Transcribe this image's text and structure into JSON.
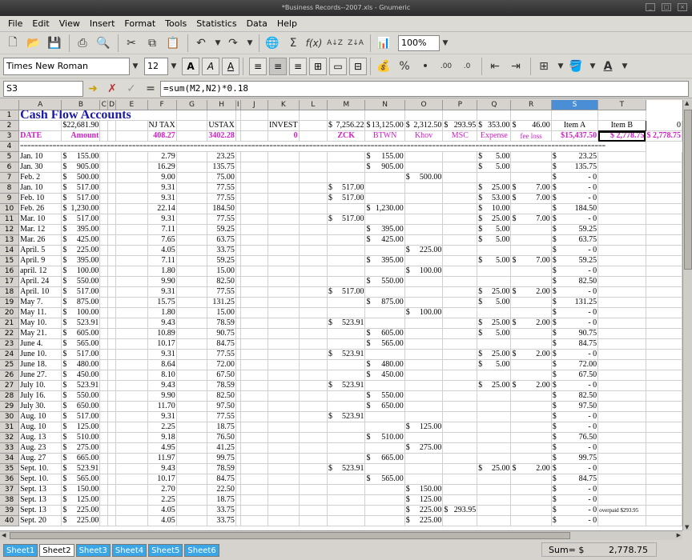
{
  "window": {
    "title": "*Business Records--2007.xls - Gnumeric"
  },
  "menu": [
    "File",
    "Edit",
    "View",
    "Insert",
    "Format",
    "Tools",
    "Statistics",
    "Data",
    "Help"
  ],
  "toolbar": {
    "zoom": "100%"
  },
  "format": {
    "font": "Times New Roman",
    "size": "12"
  },
  "formula_bar": {
    "cell_ref": "S3",
    "formula": "=sum(M2,N2)*0.18"
  },
  "columns": [
    "A",
    "B",
    "C",
    "D",
    "E",
    "F",
    "G",
    "H",
    "I",
    "J",
    "K",
    "L",
    "M",
    "N",
    "O",
    "P",
    "Q",
    "R",
    "S",
    "T"
  ],
  "visible_columns": [
    "A",
    "B",
    "C",
    "D",
    "E",
    "F",
    "G",
    "H",
    "I",
    "J",
    "K",
    "L",
    "M",
    "N",
    "O",
    "P",
    "Q",
    "R",
    "S",
    "T"
  ],
  "row1": {
    "title": "Cash Flow Accounts"
  },
  "row2": {
    "b_cur": "$",
    "b": "22,681.90",
    "e": "NJ TAX",
    "g": "USTAX",
    "j": "INVEST",
    "l_cur": "$",
    "l": "7,256.22",
    "m_cur": "$",
    "m": "13,125.00",
    "n_cur": "$",
    "n": "2,312.50",
    "o_cur": "$",
    "o": "293.95",
    "p_cur": "$",
    "p": "353.00",
    "q_cur": "$",
    "q": "46.00",
    "r": "Item A",
    "s": "Item B",
    "t": "0"
  },
  "row3": {
    "a": "DATE",
    "b": "Amount",
    "e": "408.27",
    "g": "3402.28",
    "j": "0",
    "l": "ZCK",
    "m": "BTWN",
    "n": "Khov",
    "o": "MSC",
    "p": "Expense",
    "q": "fee loss",
    "r": "$15,437.50",
    "s": "$ 2,778.75",
    "t": "$ 2,778.75"
  },
  "row4": {
    "separator": "=================================================================================================================================================================="
  },
  "rows": [
    {
      "n": 5,
      "a": "Jan. 10",
      "b": "155.00",
      "e": "2.79",
      "g": "23.25",
      "l": "",
      "m": "155.00",
      "n2": "",
      "o": "",
      "p": "5.00",
      "q": "",
      "r": "23.25",
      "s": ""
    },
    {
      "n": 6,
      "a": "Jan. 30",
      "b": "905.00",
      "e": "16.29",
      "g": "135.75",
      "l": "",
      "m": "905.00",
      "n2": "",
      "o": "",
      "p": "5.00",
      "q": "",
      "r": "135.75",
      "s": ""
    },
    {
      "n": 7,
      "a": "Feb. 2",
      "b": "500.00",
      "e": "9.00",
      "g": "75.00",
      "l": "",
      "m": "",
      "n2": "500.00",
      "o": "",
      "p": "",
      "q": "",
      "r": "- 0",
      "s": ""
    },
    {
      "n": 8,
      "a": "Jan. 10",
      "b": "517.00",
      "e": "9.31",
      "g": "77.55",
      "l": "517.00",
      "m": "",
      "n2": "",
      "o": "",
      "p": "25.00",
      "q": "7.00",
      "r": "- 0",
      "s": ""
    },
    {
      "n": 9,
      "a": "Feb. 10",
      "b": "517.00",
      "e": "9.31",
      "g": "77.55",
      "l": "517.00",
      "m": "",
      "n2": "",
      "o": "",
      "p": "53.00",
      "q": "7.00",
      "r": "- 0",
      "s": ""
    },
    {
      "n": 10,
      "a": "Feb. 26",
      "b": "1,230.00",
      "e": "22.14",
      "g": "184.50",
      "l": "",
      "m": "1,230.00",
      "n2": "",
      "o": "",
      "p": "10.00",
      "q": "",
      "r": "184.50",
      "s": ""
    },
    {
      "n": 11,
      "a": "Mar. 10",
      "b": "517.00",
      "e": "9.31",
      "g": "77.55",
      "l": "517.00",
      "m": "",
      "n2": "",
      "o": "",
      "p": "25.00",
      "q": "7.00",
      "r": "- 0",
      "s": ""
    },
    {
      "n": 12,
      "a": "Mar. 12",
      "b": "395.00",
      "e": "7.11",
      "g": "59.25",
      "l": "",
      "m": "395.00",
      "n2": "",
      "o": "",
      "p": "5.00",
      "q": "",
      "r": "59.25",
      "s": ""
    },
    {
      "n": 13,
      "a": "Mar. 26",
      "b": "425.00",
      "e": "7.65",
      "g": "63.75",
      "l": "",
      "m": "425.00",
      "n2": "",
      "o": "",
      "p": "5.00",
      "q": "",
      "r": "63.75",
      "s": ""
    },
    {
      "n": 14,
      "a": "April. 5",
      "b": "225.00",
      "e": "4.05",
      "g": "33.75",
      "l": "",
      "m": "",
      "n2": "225.00",
      "o": "",
      "p": "",
      "q": "",
      "r": "- 0",
      "s": ""
    },
    {
      "n": 15,
      "a": "April. 9",
      "b": "395.00",
      "e": "7.11",
      "g": "59.25",
      "l": "",
      "m": "395.00",
      "n2": "",
      "o": "",
      "p": "5.00",
      "q": "7.00",
      "r": "59.25",
      "s": ""
    },
    {
      "n": 16,
      "a": "april. 12",
      "b": "100.00",
      "e": "1.80",
      "g": "15.00",
      "l": "",
      "m": "",
      "n2": "100.00",
      "o": "",
      "p": "",
      "q": "",
      "r": "- 0",
      "s": ""
    },
    {
      "n": 17,
      "a": "April. 24",
      "b": "550.00",
      "e": "9.90",
      "g": "82.50",
      "l": "",
      "m": "550.00",
      "n2": "",
      "o": "",
      "p": "",
      "q": "",
      "r": "82.50",
      "s": ""
    },
    {
      "n": 18,
      "a": "April. 10",
      "b": "517.00",
      "e": "9.31",
      "g": "77.55",
      "l": "517.00",
      "m": "",
      "n2": "",
      "o": "",
      "p": "25.00",
      "q": "2.00",
      "r": "- 0",
      "s": ""
    },
    {
      "n": 19,
      "a": "May 7.",
      "b": "875.00",
      "e": "15.75",
      "g": "131.25",
      "l": "",
      "m": "875.00",
      "n2": "",
      "o": "",
      "p": "5.00",
      "q": "",
      "r": "131.25",
      "s": ""
    },
    {
      "n": 20,
      "a": "May 11.",
      "b": "100.00",
      "e": "1.80",
      "g": "15.00",
      "l": "",
      "m": "",
      "n2": "100.00",
      "o": "",
      "p": "",
      "q": "",
      "r": "- 0",
      "s": ""
    },
    {
      "n": 21,
      "a": "May 10.",
      "b": "523.91",
      "e": "9.43",
      "g": "78.59",
      "l": "523.91",
      "m": "",
      "n2": "",
      "o": "",
      "p": "25.00",
      "q": "2.00",
      "r": "- 0",
      "s": ""
    },
    {
      "n": 22,
      "a": "May 21.",
      "b": "605.00",
      "e": "10.89",
      "g": "90.75",
      "l": "",
      "m": "605.00",
      "n2": "",
      "o": "",
      "p": "5.00",
      "q": "",
      "r": "90.75",
      "s": ""
    },
    {
      "n": 23,
      "a": "June 4.",
      "b": "565.00",
      "e": "10.17",
      "g": "84.75",
      "l": "",
      "m": "565.00",
      "n2": "",
      "o": "",
      "p": "",
      "q": "",
      "r": "84.75",
      "s": ""
    },
    {
      "n": 24,
      "a": "June 10.",
      "b": "517.00",
      "e": "9.31",
      "g": "77.55",
      "l": "523.91",
      "m": "",
      "n2": "",
      "o": "",
      "p": "25.00",
      "q": "2.00",
      "r": "- 0",
      "s": ""
    },
    {
      "n": 25,
      "a": "June 18.",
      "b": "480.00",
      "e": "8.64",
      "g": "72.00",
      "l": "",
      "m": "480.00",
      "n2": "",
      "o": "",
      "p": "5.00",
      "q": "",
      "r": "72.00",
      "s": ""
    },
    {
      "n": 26,
      "a": "June 27.",
      "b": "450.00",
      "e": "8.10",
      "g": "67.50",
      "l": "",
      "m": "450.00",
      "n2": "",
      "o": "",
      "p": "",
      "q": "",
      "r": "67.50",
      "s": ""
    },
    {
      "n": 27,
      "a": "July 10.",
      "b": "523.91",
      "e": "9.43",
      "g": "78.59",
      "l": "523.91",
      "m": "",
      "n2": "",
      "o": "",
      "p": "25.00",
      "q": "2.00",
      "r": "- 0",
      "s": ""
    },
    {
      "n": 28,
      "a": "July 16.",
      "b": "550.00",
      "e": "9.90",
      "g": "82.50",
      "l": "",
      "m": "550.00",
      "n2": "",
      "o": "",
      "p": "",
      "q": "",
      "r": "82.50",
      "s": ""
    },
    {
      "n": 29,
      "a": "July 30.",
      "b": "650.00",
      "e": "11.70",
      "g": "97.50",
      "l": "",
      "m": "650.00",
      "n2": "",
      "o": "",
      "p": "",
      "q": "",
      "r": "97.50",
      "s": ""
    },
    {
      "n": 30,
      "a": "Aug. 10",
      "b": "517.00",
      "e": "9.31",
      "g": "77.55",
      "l": "523.91",
      "m": "",
      "n2": "",
      "o": "",
      "p": "",
      "q": "",
      "r": "- 0",
      "s": ""
    },
    {
      "n": 31,
      "a": "Aug. 10",
      "b": "125.00",
      "e": "2.25",
      "g": "18.75",
      "l": "",
      "m": "",
      "n2": "125.00",
      "o": "",
      "p": "",
      "q": "",
      "r": "- 0",
      "s": ""
    },
    {
      "n": 32,
      "a": "Aug. 13",
      "b": "510.00",
      "e": "9.18",
      "g": "76.50",
      "l": "",
      "m": "510.00",
      "n2": "",
      "o": "",
      "p": "",
      "q": "",
      "r": "76.50",
      "s": ""
    },
    {
      "n": 33,
      "a": "Aug. 23",
      "b": "275.00",
      "e": "4.95",
      "g": "41.25",
      "l": "",
      "m": "",
      "n2": "275.00",
      "o": "",
      "p": "",
      "q": "",
      "r": "- 0",
      "s": ""
    },
    {
      "n": 34,
      "a": "Aug. 27",
      "b": "665.00",
      "e": "11.97",
      "g": "99.75",
      "l": "",
      "m": "665.00",
      "n2": "",
      "o": "",
      "p": "",
      "q": "",
      "r": "99.75",
      "s": ""
    },
    {
      "n": 35,
      "a": "Sept. 10.",
      "b": "523.91",
      "e": "9.43",
      "g": "78.59",
      "l": "523.91",
      "m": "",
      "n2": "",
      "o": "",
      "p": "25.00",
      "q": "2.00",
      "r": "- 0",
      "s": ""
    },
    {
      "n": 36,
      "a": "Sept. 10.",
      "b": "565.00",
      "e": "10.17",
      "g": "84.75",
      "l": "",
      "m": "565.00",
      "n2": "",
      "o": "",
      "p": "",
      "q": "",
      "r": "84.75",
      "s": ""
    },
    {
      "n": 37,
      "a": "Sept. 13",
      "b": "150.00",
      "e": "2.70",
      "g": "22.50",
      "l": "",
      "m": "",
      "n2": "150.00",
      "o": "",
      "p": "",
      "q": "",
      "r": "- 0",
      "s": ""
    },
    {
      "n": 38,
      "a": "Sept. 13",
      "b": "125.00",
      "e": "2.25",
      "g": "18.75",
      "l": "",
      "m": "",
      "n2": "125.00",
      "o": "",
      "p": "",
      "q": "",
      "r": "- 0",
      "s": ""
    },
    {
      "n": 39,
      "a": "Sept. 13",
      "b": "225.00",
      "e": "4.05",
      "g": "33.75",
      "l": "",
      "m": "",
      "n2": "225.00",
      "o": "293.95",
      "p": "",
      "q": "",
      "r": "- 0",
      "s": "overpaid $293.95"
    },
    {
      "n": 40,
      "a": "Sept. 20",
      "b": "225.00",
      "e": "4.05",
      "g": "33.75",
      "l": "",
      "m": "",
      "n2": "225.00",
      "o": "",
      "p": "",
      "q": "",
      "r": "- 0",
      "s": ""
    }
  ],
  "sheets": [
    "Sheet1",
    "Sheet2",
    "Sheet3",
    "Sheet4",
    "Sheet5",
    "Sheet6"
  ],
  "active_sheet": "Sheet2",
  "status": {
    "label": "Sum= $",
    "value": "2,778.75"
  }
}
